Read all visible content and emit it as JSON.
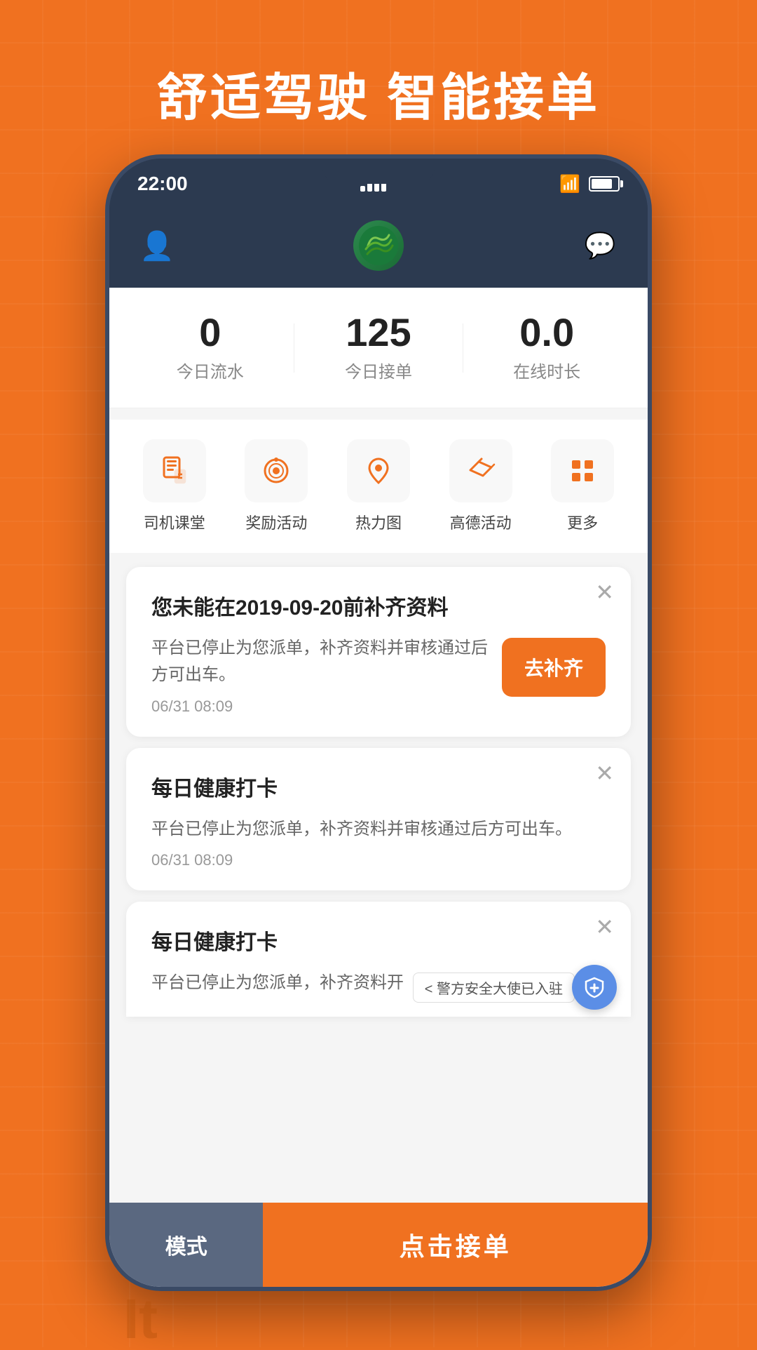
{
  "hero": {
    "tagline": "舒适驾驶  智能接单"
  },
  "statusBar": {
    "time": "22:00",
    "signal": "full",
    "wifi": true,
    "battery": 80
  },
  "header": {
    "userIconLabel": "用户",
    "chatIconLabel": "消息"
  },
  "stats": [
    {
      "value": "0",
      "label": "今日流水"
    },
    {
      "value": "125",
      "label": "今日接单"
    },
    {
      "value": "0.0",
      "label": "在线时长"
    }
  ],
  "quickNav": [
    {
      "id": "classroom",
      "label": "司机课堂",
      "icon": "📋"
    },
    {
      "id": "activity",
      "label": "奖励活动",
      "icon": "🎯"
    },
    {
      "id": "heatmap",
      "label": "热力图",
      "icon": "📍"
    },
    {
      "id": "gaode",
      "label": "高德活动",
      "icon": "✈"
    },
    {
      "id": "more",
      "label": "更多",
      "icon": "⊞"
    }
  ],
  "cards": [
    {
      "id": "card1",
      "title": "您未能在2019-09-20前补齐资料",
      "text": "平台已停止为您派单，补齐资料并审核通过后方可出车。",
      "date": "06/31 08:09",
      "hasAction": true,
      "actionLabel": "去补齐"
    },
    {
      "id": "card2",
      "title": "每日健康打卡",
      "text": "平台已停止为您派单，补齐资料并审核通过后方可出车。",
      "date": "06/31 08:09",
      "hasAction": false,
      "actionLabel": ""
    },
    {
      "id": "card3",
      "title": "每日健康打卡",
      "text": "平台已停止为您派单，补齐资料开",
      "hasAction": false,
      "partial": true
    }
  ],
  "securityBanner": "< 警方安全大使已入驻",
  "bottomBar": {
    "modeLabel": "模式",
    "acceptLabel": "点击接单"
  },
  "bottomDecoration": "It"
}
